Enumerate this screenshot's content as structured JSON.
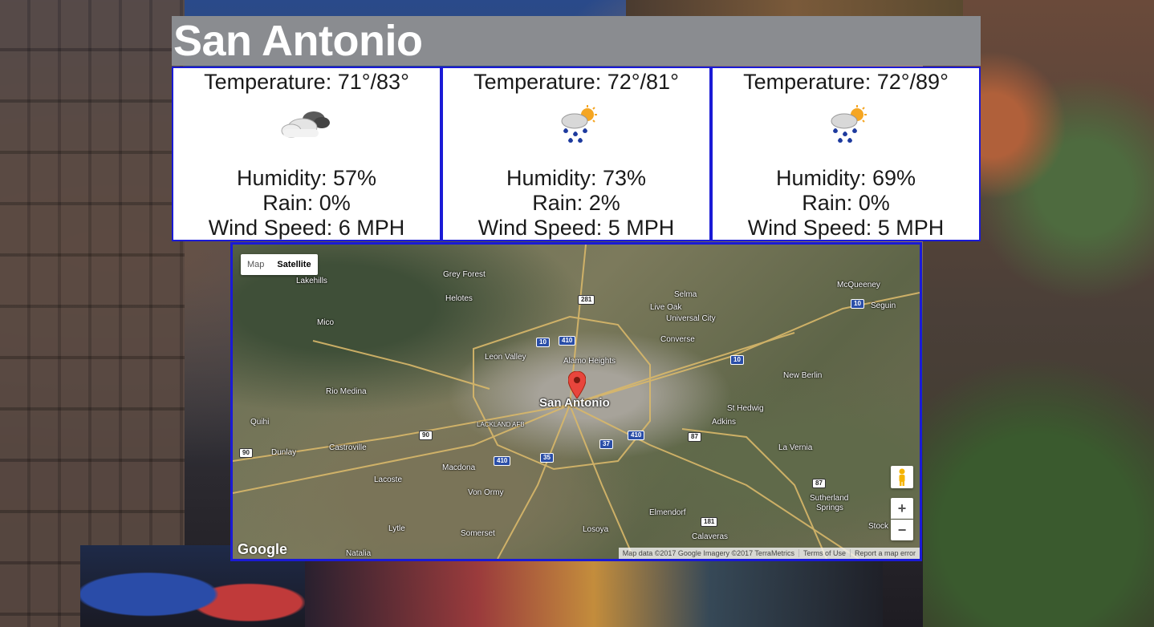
{
  "city": {
    "name": "San Antonio"
  },
  "forecast": [
    {
      "temperature": "Temperature: 71°/83°",
      "icon": "cloudy-icon",
      "humidity": "Humidity: 57%",
      "rain": "Rain: 0%",
      "wind": "Wind Speed: 6 MPH"
    },
    {
      "temperature": "Temperature: 72°/81°",
      "icon": "rain-sun-icon",
      "humidity": "Humidity: 73%",
      "rain": "Rain: 2%",
      "wind": "Wind Speed: 5 MPH"
    },
    {
      "temperature": "Temperature: 72°/89°",
      "icon": "rain-sun-icon",
      "humidity": "Humidity: 69%",
      "rain": "Rain: 0%",
      "wind": "Wind Speed: 5 MPH"
    }
  ],
  "map": {
    "type_controls": {
      "map": "Map",
      "satellite": "Satellite"
    },
    "zoom_in": "+",
    "zoom_out": "−",
    "logo": "Google",
    "attribution": {
      "data": "Map data ©2017 Google Imagery ©2017 TerraMetrics",
      "terms": "Terms of Use",
      "report": "Report a map error"
    },
    "places": {
      "lakehills": "Lakehills",
      "grey_forest": "Grey Forest",
      "helotes": "Helotes",
      "mico": "Mico",
      "leon_valley": "Leon Valley",
      "alamo_heights": "Alamo Heights",
      "selma": "Selma",
      "live_oak": "Live Oak",
      "universal_city": "Universal City",
      "converse": "Converse",
      "mcqueeney": "McQueeney",
      "seguin": "Seguin",
      "new_berlin": "New Berlin",
      "rio_medina": "Rio Medina",
      "san_antonio": "San Antonio",
      "lackland": "LACKLAND AFB",
      "st_hedwig": "St Hedwig",
      "adkins": "Adkins",
      "quihi": "Quihi",
      "castroville": "Castroville",
      "dunlay": "Dunlay",
      "la_vernia": "La Vernia",
      "macdona": "Macdona",
      "lacoste": "Lacoste",
      "von_ormy": "Von Ormy",
      "sutherland_springs_1": "Sutherland",
      "sutherland_springs_2": "Springs",
      "elmendorf": "Elmendorf",
      "lytle": "Lytle",
      "somerset": "Somerset",
      "losoya": "Losoya",
      "calaveras": "Calaveras",
      "stockdale": "Stock",
      "natalia": "Natalia"
    },
    "shields": {
      "i281": "281",
      "i410_n": "410",
      "i10_n": "10",
      "i10_e": "10",
      "i10_seguin": "10",
      "i90": "90",
      "i90_w": "90",
      "i37": "37",
      "i410_s": "410",
      "i410_sw": "410",
      "i35": "35",
      "i87": "87",
      "i87_s": "87",
      "i181": "181"
    }
  }
}
